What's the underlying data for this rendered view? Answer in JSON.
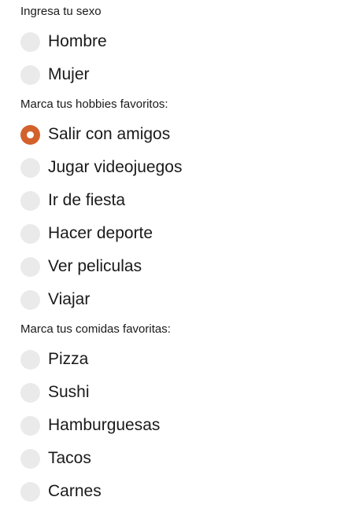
{
  "colors": {
    "accent": "#d2612c",
    "radio_unchecked": "#eaeaea",
    "text": "#1a1a1a"
  },
  "sexo": {
    "label": "Ingresa tu sexo",
    "options": [
      {
        "label": "Hombre",
        "checked": false
      },
      {
        "label": "Mujer",
        "checked": false
      }
    ]
  },
  "hobbies": {
    "label": "Marca tus hobbies favoritos:",
    "options": [
      {
        "label": "Salir con amigos",
        "checked": true
      },
      {
        "label": "Jugar videojuegos",
        "checked": false
      },
      {
        "label": "Ir de fiesta",
        "checked": false
      },
      {
        "label": "Hacer deporte",
        "checked": false
      },
      {
        "label": "Ver peliculas",
        "checked": false
      },
      {
        "label": "Viajar",
        "checked": false
      }
    ]
  },
  "comidas": {
    "label": "Marca tus comidas favoritas:",
    "options": [
      {
        "label": "Pizza",
        "checked": false
      },
      {
        "label": "Sushi",
        "checked": false
      },
      {
        "label": "Hamburguesas",
        "checked": false
      },
      {
        "label": "Tacos",
        "checked": false
      },
      {
        "label": "Carnes",
        "checked": false
      }
    ]
  }
}
